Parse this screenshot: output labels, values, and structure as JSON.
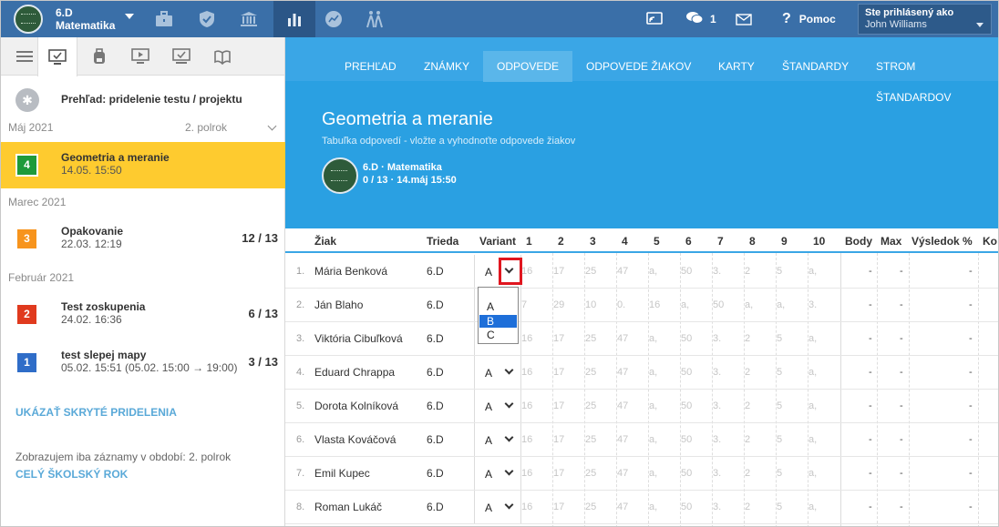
{
  "topbar": {
    "class_name": "6.D",
    "subject": "Matematika",
    "notifications_count": "1",
    "help_label": "Pomoc",
    "login_label": "Ste prihlásený ako",
    "user_name": "John Williams"
  },
  "sidebar": {
    "overview_label": "Prehľad: pridelenie testu / projektu",
    "semester": "2. polrok",
    "months": [
      "Máj 2021",
      "Marec 2021",
      "Február 2021"
    ],
    "assignments": [
      {
        "num": "4",
        "title": "Geometria a meranie",
        "date": "14.05. 15:50",
        "score": "",
        "color": "#1e9a3a"
      },
      {
        "num": "3",
        "title": "Opakovanie",
        "date": "22.03. 12:19",
        "score": "12 / 13",
        "color": "#f7941d"
      },
      {
        "num": "2",
        "title": "Test zoskupenia",
        "date": "24.02. 16:36",
        "score": "6 / 13",
        "color": "#e03a1e"
      },
      {
        "num": "1",
        "title": "test slepej mapy",
        "date": "05.02. 15:51 (05.02. 15:00 → 19:00)",
        "score": "3 / 13",
        "color": "#2f6dc8"
      }
    ],
    "show_hidden": "UKÁZAŤ SKRYTÉ PRIDELENIA",
    "period_note": "Zobrazujem iba záznamy v období: 2. polrok",
    "whole_year": "CELÝ ŠKOLSKÝ ROK"
  },
  "nav": {
    "tabs": [
      "PREHĽAD",
      "ZNÁMKY",
      "ODPOVEDE",
      "ODPOVEDE ŽIAKOV",
      "KARTY",
      "ŠTANDARDY",
      "STROM ŠTANDARDOV"
    ]
  },
  "hero": {
    "title": "Geometria a meranie",
    "subtitle": "Tabuľka odpovedí - vložte a vyhodnoťte odpovede žiakov",
    "class_label": "6.D · Matematika",
    "info": "0 / 13 · 14.máj 15:50"
  },
  "table": {
    "headers": {
      "student": "Žiak",
      "class": "Trieda",
      "variant": "Variant",
      "questions": [
        "1",
        "2",
        "3",
        "4",
        "5",
        "6",
        "7",
        "8",
        "9",
        "10"
      ],
      "points": "Body",
      "max": "Max",
      "result": "Výsledok %",
      "extra": "Ko"
    },
    "rows": [
      {
        "n": "1.",
        "name": "Mária Benková",
        "cls": "6.D",
        "variant": "A",
        "answers": [
          "16",
          "17",
          "25",
          "47",
          "a,",
          "50",
          "3.",
          "2",
          "5",
          "a,"
        ]
      },
      {
        "n": "2.",
        "name": "Ján Blaho",
        "cls": "6.D",
        "variant": "",
        "answers": [
          "7",
          "29",
          "10",
          "0.",
          "16",
          "a,",
          "50",
          "a,",
          "a,",
          "3."
        ]
      },
      {
        "n": "3.",
        "name": "Viktória Cibuľková",
        "cls": "6.D",
        "variant": "",
        "answers": [
          "16",
          "17",
          "25",
          "47",
          "a,",
          "50",
          "3.",
          "2",
          "5",
          "a,"
        ]
      },
      {
        "n": "4.",
        "name": "Eduard Chrappa",
        "cls": "6.D",
        "variant": "A",
        "answers": [
          "16",
          "17",
          "25",
          "47",
          "a,",
          "50",
          "3.",
          "2",
          "5",
          "a,"
        ]
      },
      {
        "n": "5.",
        "name": "Dorota Kolníková",
        "cls": "6.D",
        "variant": "A",
        "answers": [
          "16",
          "17",
          "25",
          "47",
          "a,",
          "50",
          "3.",
          "2",
          "5",
          "a,"
        ]
      },
      {
        "n": "6.",
        "name": "Vlasta Kováčová",
        "cls": "6.D",
        "variant": "A",
        "answers": [
          "16",
          "17",
          "25",
          "47",
          "a,",
          "50",
          "3.",
          "2",
          "5",
          "a,"
        ]
      },
      {
        "n": "7.",
        "name": "Emil Kupec",
        "cls": "6.D",
        "variant": "A",
        "answers": [
          "16",
          "17",
          "25",
          "47",
          "a,",
          "50",
          "3.",
          "2",
          "5",
          "a,"
        ]
      },
      {
        "n": "8.",
        "name": "Roman Lukáč",
        "cls": "6.D",
        "variant": "A",
        "answers": [
          "16",
          "17",
          "25",
          "47",
          "a,",
          "50",
          "3.",
          "2",
          "5",
          "a,"
        ]
      }
    ],
    "dash": "-"
  },
  "dropdown": {
    "options": [
      "A",
      "B",
      "C"
    ],
    "highlighted": "B"
  }
}
